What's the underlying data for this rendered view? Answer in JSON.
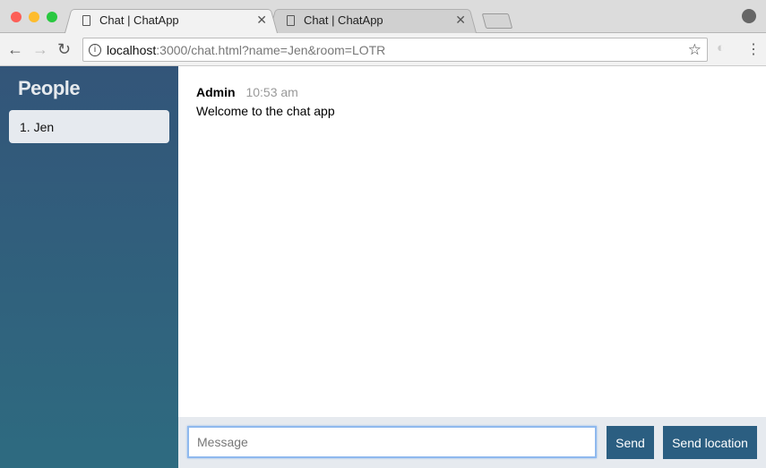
{
  "browser": {
    "tabs": [
      {
        "title": "Chat | ChatApp",
        "active": true
      },
      {
        "title": "Chat | ChatApp",
        "active": false
      }
    ],
    "url_host": "localhost",
    "url_rest": ":3000/chat.html?name=Jen&room=LOTR"
  },
  "sidebar": {
    "title": "People",
    "users": [
      "1. Jen"
    ]
  },
  "messages": [
    {
      "from": "Admin",
      "time": "10:53 am",
      "text": "Welcome to the chat app"
    }
  ],
  "form": {
    "placeholder": "Message",
    "send": "Send",
    "send_location": "Send location"
  },
  "colors": {
    "accent": "#2b5e81"
  }
}
